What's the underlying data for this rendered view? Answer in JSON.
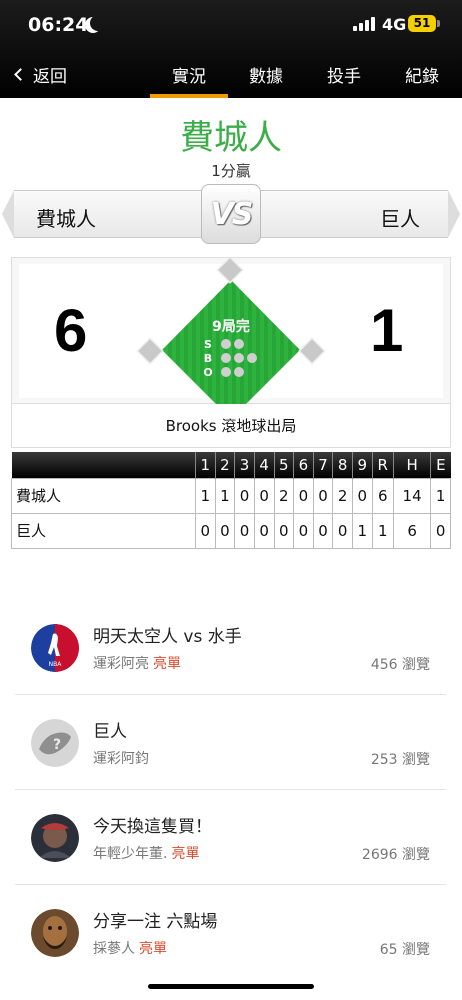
{
  "status_bar": {
    "time": "06:24",
    "network": "4G",
    "battery": "51"
  },
  "nav": {
    "back_label": "返回",
    "tabs": [
      {
        "label": "實況",
        "active": true
      },
      {
        "label": "數據",
        "active": false
      },
      {
        "label": "投手",
        "active": false
      },
      {
        "label": "紀錄",
        "active": false
      }
    ]
  },
  "game": {
    "winner_title": "費城人",
    "result_text": "1分贏",
    "vs_label": "VS",
    "away_team": "費城人",
    "home_team": "巨人",
    "away_score": "6",
    "home_score": "1",
    "inning_status": "9局完",
    "count_labels": {
      "s": "S",
      "b": "B",
      "o": "O"
    },
    "last_play": "Brooks 滾地球出局",
    "colors": {
      "accent": "#f39a00",
      "title": "#3cae49",
      "field": "#2db33e",
      "tag": "#e04a2b"
    }
  },
  "linescore": {
    "headers": [
      "1",
      "2",
      "3",
      "4",
      "5",
      "6",
      "7",
      "8",
      "9",
      "R",
      "H",
      "E"
    ],
    "rows": [
      {
        "team": "費城人",
        "values": [
          "1",
          "1",
          "0",
          "0",
          "2",
          "0",
          "0",
          "2",
          "0",
          "6",
          "14",
          "1"
        ]
      },
      {
        "team": "巨人",
        "values": [
          "0",
          "0",
          "0",
          "0",
          "0",
          "0",
          "0",
          "0",
          "1",
          "1",
          "6",
          "0"
        ]
      }
    ]
  },
  "posts": [
    {
      "title": "明天太空人 vs 水手",
      "author": "運彩阿亮",
      "tag": "亮單",
      "views": "456 瀏覽",
      "avatar_icon": "nba-logo-icon"
    },
    {
      "title": "巨人",
      "author": "運彩阿鈞",
      "tag": "",
      "views": "253 瀏覽",
      "avatar_icon": "default-avatar-icon"
    },
    {
      "title": "今天換這隻買！",
      "author": "年輕少年董.",
      "tag": "亮單",
      "views": "2696 瀏覽",
      "avatar_icon": "user-photo-icon"
    },
    {
      "title": "分享一注 六點場",
      "author": "採蔘人",
      "tag": "亮單",
      "views": "65 瀏覽",
      "avatar_icon": "user-photo-icon"
    }
  ]
}
